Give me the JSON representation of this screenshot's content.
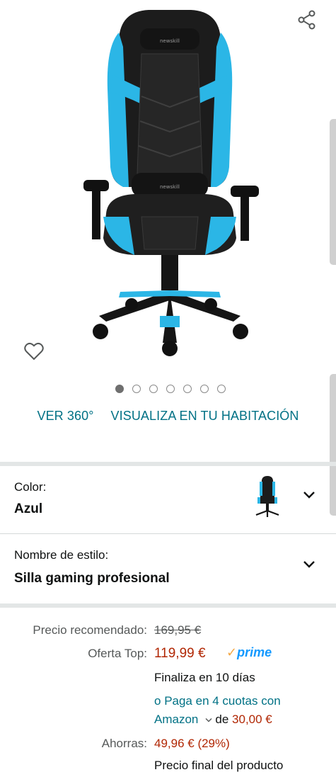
{
  "gallery": {
    "share_icon": "share-icon",
    "favorite_icon": "heart-outline-icon",
    "image_alt": "gaming-chair-blue-black",
    "dot_count": 7,
    "active_dot": 0,
    "links": {
      "view_360": "VER 360°",
      "view_in_room": "VISUALIZA EN TU HABITACIÓN"
    }
  },
  "variations": {
    "color": {
      "label": "Color:",
      "value": "Azul",
      "icon": "chevron-down-icon"
    },
    "style": {
      "label": "Nombre de estilo:",
      "value": "Silla gaming profesional",
      "icon": "chevron-down-icon"
    }
  },
  "pricing": {
    "list_label": "Precio recomendado:",
    "list_price": "169,95 €",
    "deal_label": "Oferta Top:",
    "deal_price": "119,99 €",
    "prime_check": "✓",
    "prime_text": "prime",
    "ends_text": "Finaliza en 10 días",
    "installment_prefix": "o ",
    "installment_link_1": "Paga en 4 cuotas con",
    "installment_link_2": "Amazon",
    "installment_of": "de",
    "installment_amount": "30,00 €",
    "savings_label": "Ahorras:",
    "savings_value": "49,96 € (29%)",
    "final_price_text": "Precio final del producto"
  },
  "colors": {
    "link": "#007185",
    "price": "#b12704",
    "prime": "#1399ff",
    "chair_accent": "#2bb6e6"
  }
}
